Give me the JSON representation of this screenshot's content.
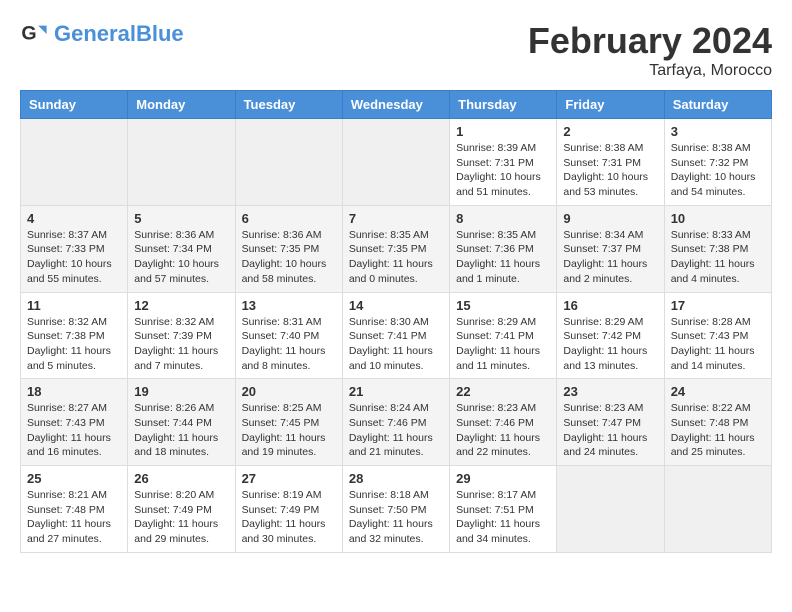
{
  "header": {
    "logo_general": "General",
    "logo_blue": "Blue",
    "month_title": "February 2024",
    "location": "Tarfaya, Morocco"
  },
  "weekdays": [
    "Sunday",
    "Monday",
    "Tuesday",
    "Wednesday",
    "Thursday",
    "Friday",
    "Saturday"
  ],
  "weeks": [
    [
      {
        "day": "",
        "info": ""
      },
      {
        "day": "",
        "info": ""
      },
      {
        "day": "",
        "info": ""
      },
      {
        "day": "",
        "info": ""
      },
      {
        "day": "1",
        "info": "Sunrise: 8:39 AM\nSunset: 7:31 PM\nDaylight: 10 hours\nand 51 minutes."
      },
      {
        "day": "2",
        "info": "Sunrise: 8:38 AM\nSunset: 7:31 PM\nDaylight: 10 hours\nand 53 minutes."
      },
      {
        "day": "3",
        "info": "Sunrise: 8:38 AM\nSunset: 7:32 PM\nDaylight: 10 hours\nand 54 minutes."
      }
    ],
    [
      {
        "day": "4",
        "info": "Sunrise: 8:37 AM\nSunset: 7:33 PM\nDaylight: 10 hours\nand 55 minutes."
      },
      {
        "day": "5",
        "info": "Sunrise: 8:36 AM\nSunset: 7:34 PM\nDaylight: 10 hours\nand 57 minutes."
      },
      {
        "day": "6",
        "info": "Sunrise: 8:36 AM\nSunset: 7:35 PM\nDaylight: 10 hours\nand 58 minutes."
      },
      {
        "day": "7",
        "info": "Sunrise: 8:35 AM\nSunset: 7:35 PM\nDaylight: 11 hours\nand 0 minutes."
      },
      {
        "day": "8",
        "info": "Sunrise: 8:35 AM\nSunset: 7:36 PM\nDaylight: 11 hours\nand 1 minute."
      },
      {
        "day": "9",
        "info": "Sunrise: 8:34 AM\nSunset: 7:37 PM\nDaylight: 11 hours\nand 2 minutes."
      },
      {
        "day": "10",
        "info": "Sunrise: 8:33 AM\nSunset: 7:38 PM\nDaylight: 11 hours\nand 4 minutes."
      }
    ],
    [
      {
        "day": "11",
        "info": "Sunrise: 8:32 AM\nSunset: 7:38 PM\nDaylight: 11 hours\nand 5 minutes."
      },
      {
        "day": "12",
        "info": "Sunrise: 8:32 AM\nSunset: 7:39 PM\nDaylight: 11 hours\nand 7 minutes."
      },
      {
        "day": "13",
        "info": "Sunrise: 8:31 AM\nSunset: 7:40 PM\nDaylight: 11 hours\nand 8 minutes."
      },
      {
        "day": "14",
        "info": "Sunrise: 8:30 AM\nSunset: 7:41 PM\nDaylight: 11 hours\nand 10 minutes."
      },
      {
        "day": "15",
        "info": "Sunrise: 8:29 AM\nSunset: 7:41 PM\nDaylight: 11 hours\nand 11 minutes."
      },
      {
        "day": "16",
        "info": "Sunrise: 8:29 AM\nSunset: 7:42 PM\nDaylight: 11 hours\nand 13 minutes."
      },
      {
        "day": "17",
        "info": "Sunrise: 8:28 AM\nSunset: 7:43 PM\nDaylight: 11 hours\nand 14 minutes."
      }
    ],
    [
      {
        "day": "18",
        "info": "Sunrise: 8:27 AM\nSunset: 7:43 PM\nDaylight: 11 hours\nand 16 minutes."
      },
      {
        "day": "19",
        "info": "Sunrise: 8:26 AM\nSunset: 7:44 PM\nDaylight: 11 hours\nand 18 minutes."
      },
      {
        "day": "20",
        "info": "Sunrise: 8:25 AM\nSunset: 7:45 PM\nDaylight: 11 hours\nand 19 minutes."
      },
      {
        "day": "21",
        "info": "Sunrise: 8:24 AM\nSunset: 7:46 PM\nDaylight: 11 hours\nand 21 minutes."
      },
      {
        "day": "22",
        "info": "Sunrise: 8:23 AM\nSunset: 7:46 PM\nDaylight: 11 hours\nand 22 minutes."
      },
      {
        "day": "23",
        "info": "Sunrise: 8:23 AM\nSunset: 7:47 PM\nDaylight: 11 hours\nand 24 minutes."
      },
      {
        "day": "24",
        "info": "Sunrise: 8:22 AM\nSunset: 7:48 PM\nDaylight: 11 hours\nand 25 minutes."
      }
    ],
    [
      {
        "day": "25",
        "info": "Sunrise: 8:21 AM\nSunset: 7:48 PM\nDaylight: 11 hours\nand 27 minutes."
      },
      {
        "day": "26",
        "info": "Sunrise: 8:20 AM\nSunset: 7:49 PM\nDaylight: 11 hours\nand 29 minutes."
      },
      {
        "day": "27",
        "info": "Sunrise: 8:19 AM\nSunset: 7:49 PM\nDaylight: 11 hours\nand 30 minutes."
      },
      {
        "day": "28",
        "info": "Sunrise: 8:18 AM\nSunset: 7:50 PM\nDaylight: 11 hours\nand 32 minutes."
      },
      {
        "day": "29",
        "info": "Sunrise: 8:17 AM\nSunset: 7:51 PM\nDaylight: 11 hours\nand 34 minutes."
      },
      {
        "day": "",
        "info": ""
      },
      {
        "day": "",
        "info": ""
      }
    ]
  ]
}
